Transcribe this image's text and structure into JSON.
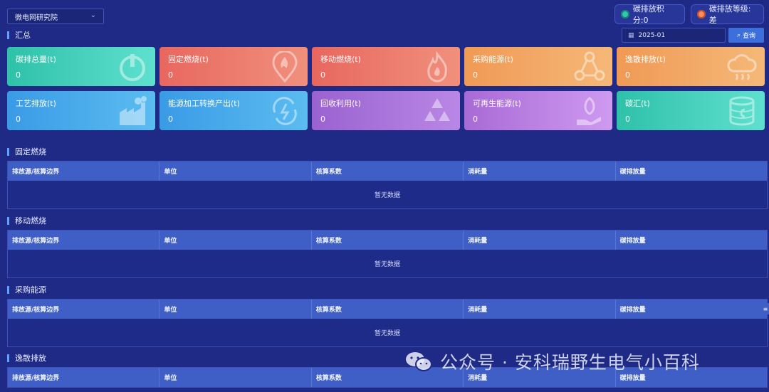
{
  "header": {
    "org_select": "微电网研究院",
    "score_badge": "碳排放积分:0",
    "level_badge": "碳排放等级:差",
    "summary_title": "汇总",
    "date_value": "2025-01",
    "query_label": "查询"
  },
  "cards": [
    {
      "label": "碳排总量(t)",
      "value": "0",
      "icon": "power-icon"
    },
    {
      "label": "固定燃烧(t)",
      "value": "0",
      "icon": "flame-pin-icon"
    },
    {
      "label": "移动燃烧(t)",
      "value": "0",
      "icon": "fire-icon"
    },
    {
      "label": "采购能源(t)",
      "value": "0",
      "icon": "network-icon"
    },
    {
      "label": "逸散排放(t)",
      "value": "0",
      "icon": "cloud-rain-icon"
    },
    {
      "label": "工艺排放(t)",
      "value": "0",
      "icon": "factory-icon"
    },
    {
      "label": "能源加工转换产出(t)",
      "value": "0",
      "icon": "energy-cycle-icon"
    },
    {
      "label": "回收利用(t)",
      "value": "0",
      "icon": "recycle-icon"
    },
    {
      "label": "可再生能源(t)",
      "value": "0",
      "icon": "plant-hand-icon"
    },
    {
      "label": "碳汇(t)",
      "value": "0",
      "icon": "carbon-storage-icon"
    }
  ],
  "columns": [
    "排放源/核算边界",
    "单位",
    "核算系数",
    "消耗量",
    "碳排放量"
  ],
  "empty_text": "暂无数据",
  "sections": [
    {
      "title": "固定燃烧"
    },
    {
      "title": "移动燃烧"
    },
    {
      "title": "采购能源"
    },
    {
      "title": "逸散排放"
    }
  ],
  "watermark": "公众号 · 安科瑞野生电气小百科",
  "colors": {
    "background": "#1e2a85",
    "table_header": "#3f5fc6",
    "accent": "#3d6fdc"
  }
}
